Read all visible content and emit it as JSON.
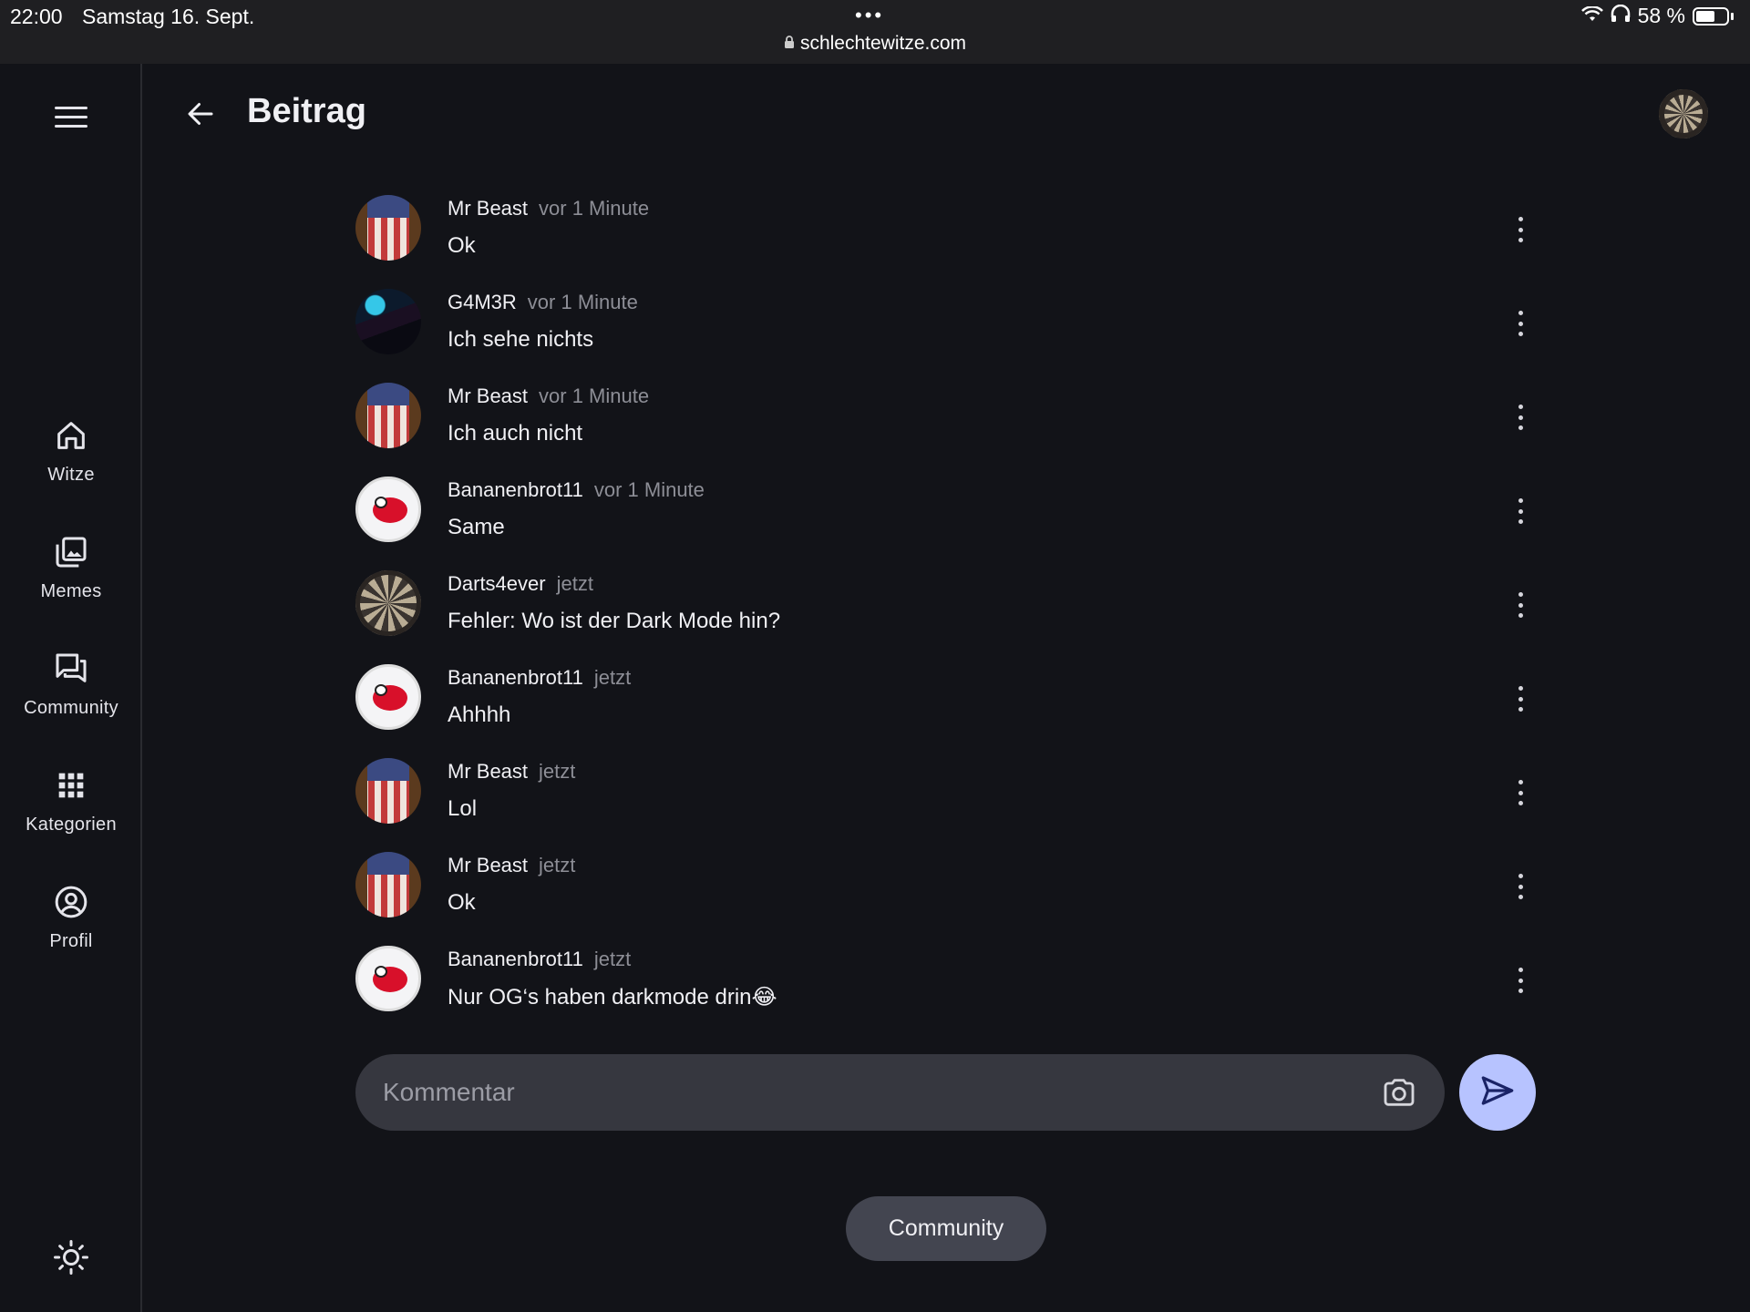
{
  "status_bar": {
    "time": "22:00",
    "date": "Samstag 16. Sept.",
    "dots": "•••",
    "url": "schlechtewitze.com",
    "battery": "58 %"
  },
  "header": {
    "title": "Beitrag"
  },
  "sidebar": {
    "items": [
      {
        "label": "Witze",
        "icon": "home-icon"
      },
      {
        "label": "Memes",
        "icon": "image-gallery-icon"
      },
      {
        "label": "Community",
        "icon": "forum-icon"
      },
      {
        "label": "Kategorien",
        "icon": "grid-icon"
      },
      {
        "label": "Profil",
        "icon": "account-circle-icon"
      }
    ]
  },
  "comments": [
    {
      "author": "Mr Beast",
      "time": "vor 1 Minute",
      "text": "Ok",
      "avatar": "flag"
    },
    {
      "author": "G4M3R",
      "time": "vor 1 Minute",
      "text": "Ich sehe nichts",
      "avatar": "gamer"
    },
    {
      "author": "Mr Beast",
      "time": "vor 1 Minute",
      "text": "Ich auch nicht",
      "avatar": "flag"
    },
    {
      "author": "Bananenbrot11",
      "time": "vor 1 Minute",
      "text": "Same",
      "avatar": "ball"
    },
    {
      "author": "Darts4ever",
      "time": "jetzt",
      "text": "Fehler: Wo ist der Dark Mode hin?",
      "avatar": "dart"
    },
    {
      "author": "Bananenbrot11",
      "time": "jetzt",
      "text": "Ahhhh",
      "avatar": "ball"
    },
    {
      "author": "Mr Beast",
      "time": "jetzt",
      "text": "Lol",
      "avatar": "flag"
    },
    {
      "author": "Mr Beast",
      "time": "jetzt",
      "text": "Ok",
      "avatar": "flag"
    },
    {
      "author": "Bananenbrot11",
      "time": "jetzt",
      "text": "Nur OG‘s haben darkmode drin😂",
      "avatar": "ball"
    }
  ],
  "composer": {
    "placeholder": "Kommentar"
  },
  "chip": {
    "label": "Community"
  },
  "colors": {
    "background": "#121318",
    "send_button": "#b7c3ff",
    "input_bg": "#36373f",
    "chip_bg": "#434550"
  }
}
